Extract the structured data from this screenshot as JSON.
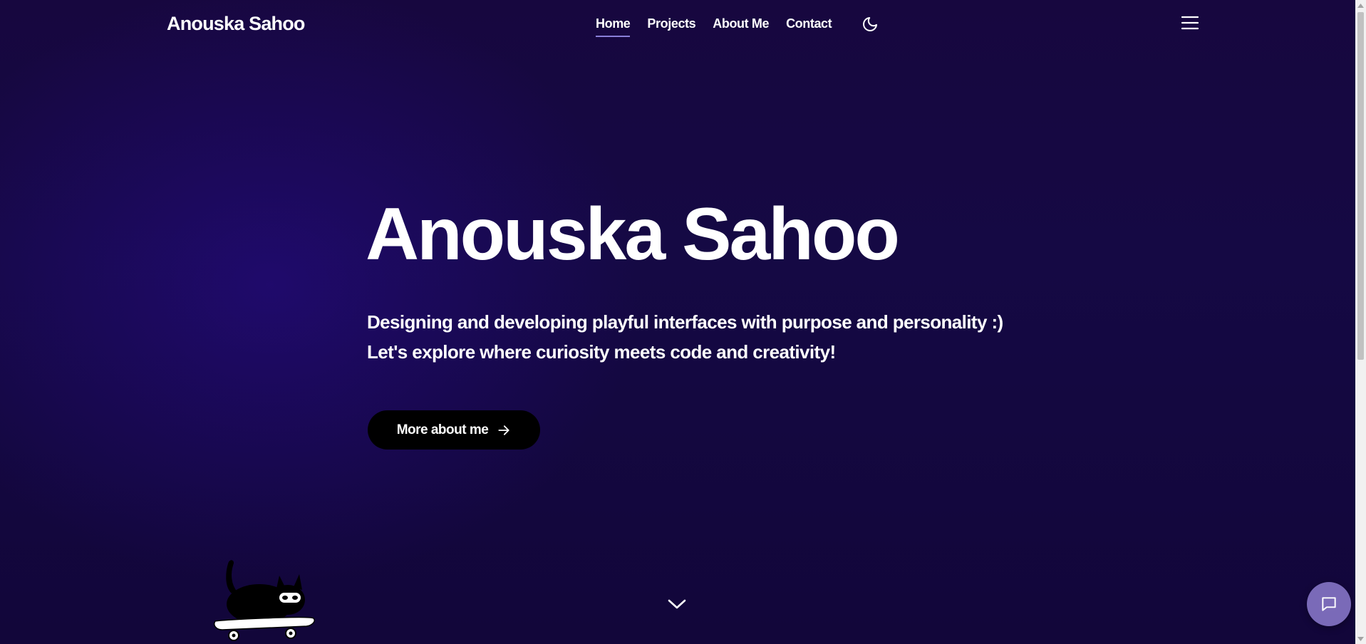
{
  "header": {
    "brand": "Anouska Sahoo",
    "nav": [
      {
        "label": "Home",
        "active": true
      },
      {
        "label": "Projects",
        "active": false
      },
      {
        "label": "About Me",
        "active": false
      },
      {
        "label": "Contact",
        "active": false
      }
    ],
    "theme_toggle_icon": "moon-icon",
    "menu_icon": "hamburger-menu-icon"
  },
  "hero": {
    "title": "Anouska Sahoo",
    "line1": "Designing and developing playful interfaces with purpose and personality :)",
    "line2": "Let's explore where curiosity meets code and creativity!",
    "cta_label": "More about me",
    "cta_icon": "arrow-right-icon",
    "scroll_icon": "chevron-down-icon"
  },
  "decor": {
    "illustration": "cat-on-skateboard-illustration"
  },
  "chat": {
    "icon": "chat-bubble-icon"
  },
  "colors": {
    "background": "#150944",
    "accent_underline": "#8a7fd9",
    "cta_background": "#000000",
    "chat_button": "#7a6ab8"
  }
}
